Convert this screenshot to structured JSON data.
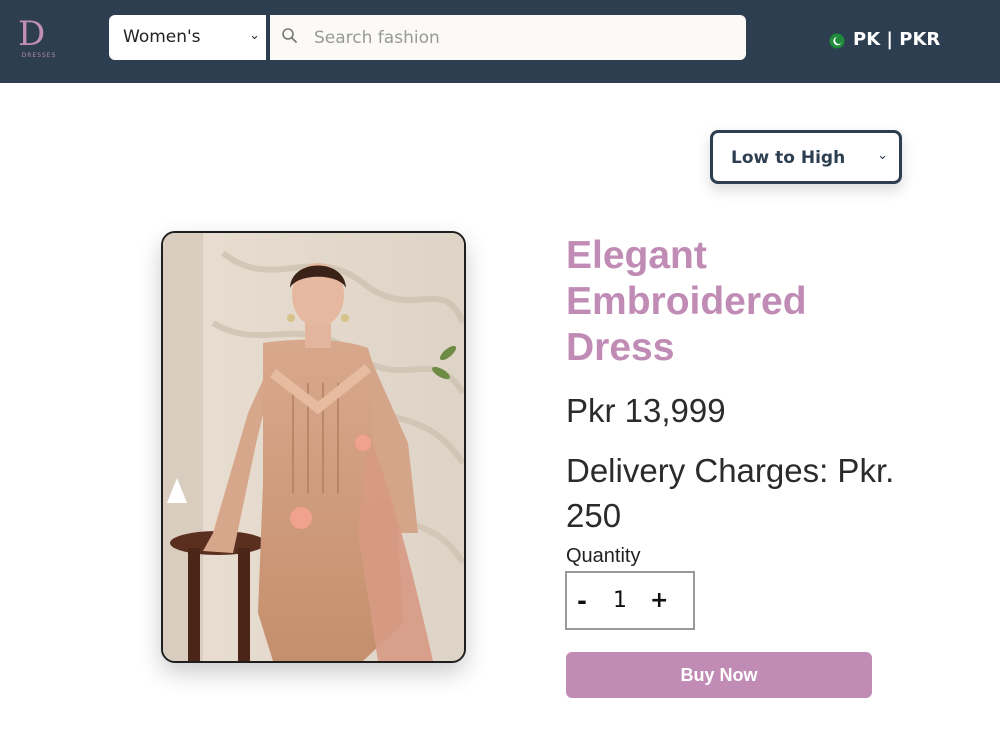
{
  "header": {
    "logo_text": "D",
    "logo_sub": "DRESSES",
    "category": "Women's",
    "search_placeholder": "Search fashion",
    "region": "PK | PKR"
  },
  "sort": {
    "selected": "Low to High"
  },
  "product": {
    "title": "Elegant Embroidered Dress",
    "price": "Pkr 13,999",
    "delivery": "Delivery Charges: Pkr. 250",
    "quantity_label": "Quantity",
    "quantity_minus": "-",
    "quantity_value": "1",
    "quantity_plus": "+",
    "buy_label": "Buy Now"
  },
  "colors": {
    "header_bg": "#2c3e50",
    "accent": "#c08bb4",
    "text_dark": "#2b2b2b"
  },
  "icons": [
    "logo-icon",
    "chevron-down-icon",
    "search-icon",
    "pakistan-flag-icon"
  ]
}
